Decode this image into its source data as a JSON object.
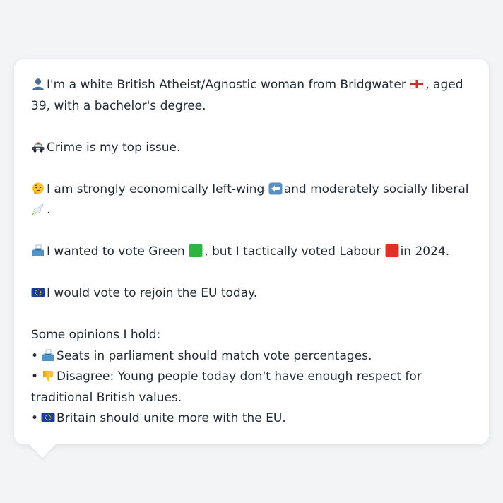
{
  "bio": {
    "identity_text": "I'm a white British Atheist/Agnostic woman from Bridgwater",
    "identity_text_2": ", aged 39, with a bachelor's degree.",
    "issue_text": "Crime is my top issue.",
    "econ_text": "I am strongly economically left-wing",
    "econ_text_2": "and moderately socially liberal",
    "econ_text_3": ".",
    "vote_text": "I wanted to vote Green",
    "vote_text_2": ", but I tactically voted Labour",
    "vote_text_3": "in 2024.",
    "eu_text": "I would vote to rejoin the EU today."
  },
  "opinions": {
    "heading": "Some opinions I hold:",
    "bullet": "•",
    "items": [
      {
        "icon": "ballot-box-icon",
        "text": "Seats in parliament should match vote percentages."
      },
      {
        "icon": "thumbs-down-icon",
        "text": "Disagree: Young people today don't have enough respect for traditional British values."
      },
      {
        "icon": "eu-flag-icon",
        "text": "Britain should unite more with the EU."
      }
    ]
  },
  "icons": {
    "person": "person-silhouette-icon",
    "england_flag": "england-flag-icon",
    "police_car": "police-car-icon",
    "thinking": "thinking-face-icon",
    "left_arrow": "left-arrow-icon",
    "dove": "dove-icon",
    "ballot": "ballot-box-icon",
    "green_square": "green-square-icon",
    "red_square": "red-square-icon",
    "eu_flag": "eu-flag-icon",
    "thumbs_down": "thumbs-down-icon"
  },
  "colors": {
    "green_party": "#2fb341",
    "labour_red": "#e0302a",
    "eu_blue": "#1c3f94"
  }
}
